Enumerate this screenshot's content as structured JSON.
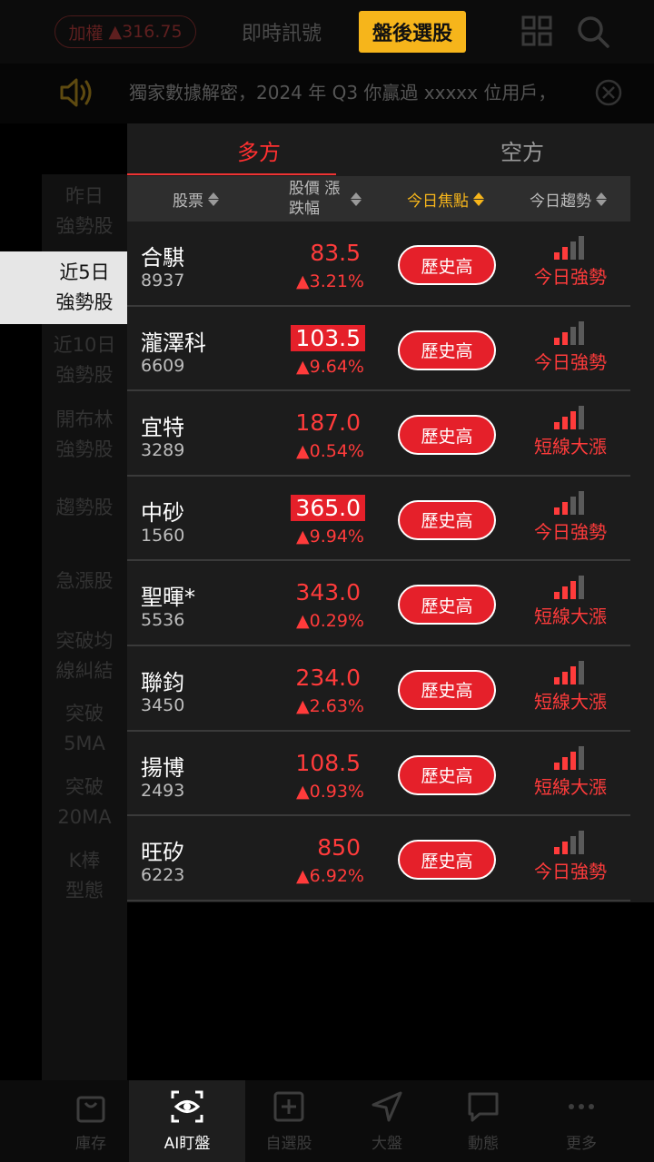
{
  "topbar": {
    "index_name": "加權",
    "index_change": "▲316.75",
    "tab_signal": "即時訊號",
    "tab_after_hours": "盤後選股"
  },
  "marquee": {
    "text": "獨家數據解密，2024 年 Q3 你贏過 xxxxx 位用戶，"
  },
  "sidebar": {
    "items": [
      {
        "line1": "昨日",
        "line2": "強勢股"
      },
      {
        "line1": "近5日",
        "line2": "強勢股"
      },
      {
        "line1": "近10日",
        "line2": "強勢股"
      },
      {
        "line1": "開布林",
        "line2": "強勢股"
      },
      {
        "line1": "趨勢股",
        "line2": ""
      },
      {
        "line1": "急漲股",
        "line2": ""
      },
      {
        "line1": "突破均",
        "line2": "線糾結"
      },
      {
        "line1": "突破",
        "line2": "5MA"
      },
      {
        "line1": "突破",
        "line2": "20MA"
      },
      {
        "line1": "K棒",
        "line2": "型態"
      }
    ]
  },
  "panel": {
    "tab_long": "多方",
    "tab_short": "空方",
    "col_stock": "股票",
    "col_price_1": "股價",
    "col_price_2": "漲跌幅",
    "col_focus": "今日焦點",
    "col_trend": "今日趨勢"
  },
  "rows": [
    {
      "name": "合騏",
      "code": "8937",
      "price": "83.5",
      "change": "▲3.21%",
      "focus": "歷史高",
      "trend": "今日強勢",
      "price_highlight": false,
      "level": 2
    },
    {
      "name": "瀧澤科",
      "code": "6609",
      "price": "103.5",
      "change": "▲9.64%",
      "focus": "歷史高",
      "trend": "今日強勢",
      "price_highlight": true,
      "level": 2
    },
    {
      "name": "宜特",
      "code": "3289",
      "price": "187.0",
      "change": "▲0.54%",
      "focus": "歷史高",
      "trend": "短線大漲",
      "price_highlight": false,
      "level": 3
    },
    {
      "name": "中砂",
      "code": "1560",
      "price": "365.0",
      "change": "▲9.94%",
      "focus": "歷史高",
      "trend": "今日強勢",
      "price_highlight": true,
      "level": 2
    },
    {
      "name": "聖暉*",
      "code": "5536",
      "price": "343.0",
      "change": "▲0.29%",
      "focus": "歷史高",
      "trend": "短線大漲",
      "price_highlight": false,
      "level": 3
    },
    {
      "name": "聯鈞",
      "code": "3450",
      "price": "234.0",
      "change": "▲2.63%",
      "focus": "歷史高",
      "trend": "短線大漲",
      "price_highlight": false,
      "level": 3
    },
    {
      "name": "揚博",
      "code": "2493",
      "price": "108.5",
      "change": "▲0.93%",
      "focus": "歷史高",
      "trend": "短線大漲",
      "price_highlight": false,
      "level": 3
    },
    {
      "name": "旺矽",
      "code": "6223",
      "price": "850",
      "change": "▲6.92%",
      "focus": "歷史高",
      "trend": "今日強勢",
      "price_highlight": false,
      "level": 2
    }
  ],
  "bottom_nav": {
    "inventory": "庫存",
    "ai_watch": "AI盯盤",
    "watchlist": "自選股",
    "market": "大盤",
    "feed": "動態",
    "more": "更多"
  },
  "colors": {
    "accent_yellow": "#f6b51b",
    "up_red": "#ff3b3b",
    "badge_red": "#e5202a"
  }
}
